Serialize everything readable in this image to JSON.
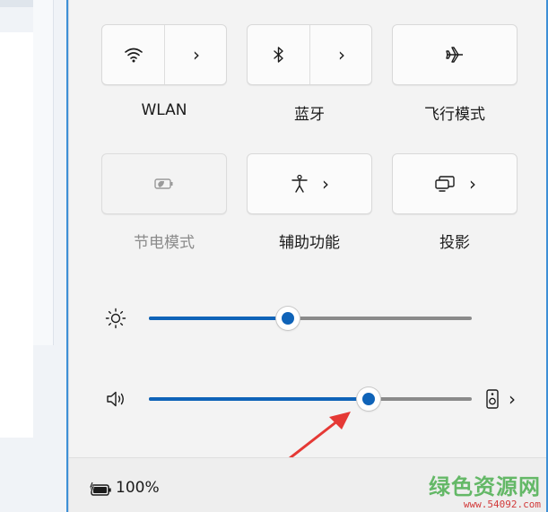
{
  "quick_settings": {
    "tiles": [
      {
        "id": "wlan",
        "label": "WLAN",
        "icon": "wifi-icon",
        "has_chevron": true,
        "enabled": true
      },
      {
        "id": "bluetooth",
        "label": "蓝牙",
        "icon": "bluetooth-icon",
        "has_chevron": true,
        "enabled": true
      },
      {
        "id": "airplane",
        "label": "飞行模式",
        "icon": "airplane-icon",
        "has_chevron": false,
        "enabled": true
      },
      {
        "id": "battery_saver",
        "label": "节电模式",
        "icon": "battery-saver-icon",
        "has_chevron": false,
        "enabled": false
      },
      {
        "id": "accessibility",
        "label": "辅助功能",
        "icon": "accessibility-icon",
        "has_chevron": true,
        "enabled": true
      },
      {
        "id": "project",
        "label": "投影",
        "icon": "project-icon",
        "has_chevron": true,
        "enabled": true
      }
    ],
    "sliders": {
      "brightness": {
        "icon": "brightness-icon",
        "value": 0.43
      },
      "volume": {
        "icon": "speaker-icon",
        "value": 0.68,
        "output_icon": "speaker-device-icon"
      }
    }
  },
  "footer": {
    "battery_text": "100%",
    "battery_icon": "battery-charging-icon"
  },
  "watermark": {
    "text": "绿色资源网",
    "url": "www.54092.com"
  },
  "colors": {
    "accent": "#0f63b8",
    "track": "#8a8a8a",
    "arrow": "#e53935"
  }
}
